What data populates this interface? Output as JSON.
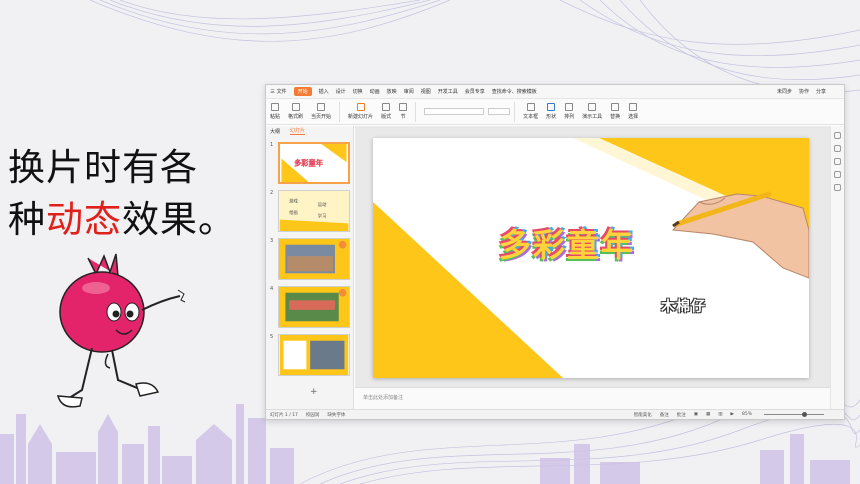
{
  "slide": {
    "caption_part1": "换片时有各",
    "caption_part2a": "种",
    "caption_part2_highlight": "动态",
    "caption_part2b": "效果。",
    "highlight_color": "#e0201a"
  },
  "app": {
    "menu": {
      "file": "三 文件",
      "tabs": [
        "开始",
        "插入",
        "设计",
        "切换",
        "动画",
        "放映",
        "审阅",
        "视图",
        "开发工具",
        "会员专享"
      ],
      "active_tab": "开始",
      "search": "查找命令、搜索模板",
      "right": [
        "未同步",
        "协作",
        "分享"
      ]
    },
    "ribbon": {
      "buttons": [
        "粘贴",
        "格式刷",
        "当页开始",
        "新建幻灯片",
        "版式",
        "节",
        "文本框",
        "形状",
        "排列",
        "演示工具",
        "替换",
        "选择"
      ],
      "font_name": "",
      "font_size": ""
    },
    "panel": {
      "tab_outline": "大纲",
      "tab_slides": "幻灯片",
      "slide_numbers": [
        "1",
        "2",
        "3",
        "4",
        "5"
      ],
      "add_symbol": "+"
    },
    "thumb2": {
      "t1": "游戏",
      "t2": "运动",
      "t3": "绘画",
      "t4": "学习"
    },
    "slide_content": {
      "title": "多彩童年",
      "subtitle": "木棉仔"
    },
    "notes_placeholder": "单击此处添加备注",
    "status": {
      "slide_count": "幻灯片 1 / 17",
      "theme": "校园润",
      "font_missing": "缺失字体",
      "smart_beautify": "智能美化",
      "notes": "备注",
      "comments": "批注",
      "zoom": "85%"
    },
    "colors": {
      "accent": "#f57a34",
      "slide_yellow": "#ffc61a"
    }
  }
}
